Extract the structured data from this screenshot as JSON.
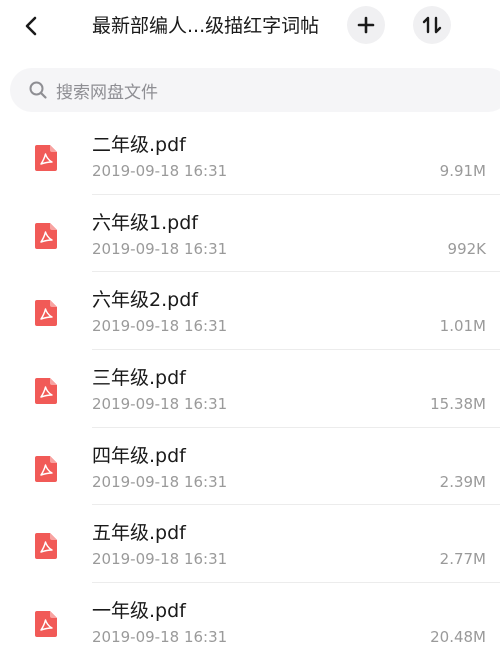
{
  "header": {
    "title": "最新部编人...级描红字词帖",
    "back_icon": "chevron-left-icon",
    "add_icon": "plus-icon",
    "sort_icon": "sort-arrows-icon"
  },
  "search": {
    "placeholder": "搜索网盘文件",
    "icon": "search-icon"
  },
  "colors": {
    "pdf_icon": "#f15a57",
    "button_bg": "#f0f0f2",
    "search_bg": "#f5f5f7",
    "secondary_text": "#9a9a9a"
  },
  "files": [
    {
      "name": "二年级.pdf",
      "date": "2019-09-18 16:31",
      "size": "9.91M",
      "icon": "pdf-icon"
    },
    {
      "name": "六年级1.pdf",
      "date": "2019-09-18 16:31",
      "size": "992K",
      "icon": "pdf-icon"
    },
    {
      "name": "六年级2.pdf",
      "date": "2019-09-18 16:31",
      "size": "1.01M",
      "icon": "pdf-icon"
    },
    {
      "name": "三年级.pdf",
      "date": "2019-09-18 16:31",
      "size": "15.38M",
      "icon": "pdf-icon"
    },
    {
      "name": "四年级.pdf",
      "date": "2019-09-18 16:31",
      "size": "2.39M",
      "icon": "pdf-icon"
    },
    {
      "name": "五年级.pdf",
      "date": "2019-09-18 16:31",
      "size": "2.77M",
      "icon": "pdf-icon"
    },
    {
      "name": "一年级.pdf",
      "date": "2019-09-18 16:31",
      "size": "20.48M",
      "icon": "pdf-icon"
    }
  ]
}
